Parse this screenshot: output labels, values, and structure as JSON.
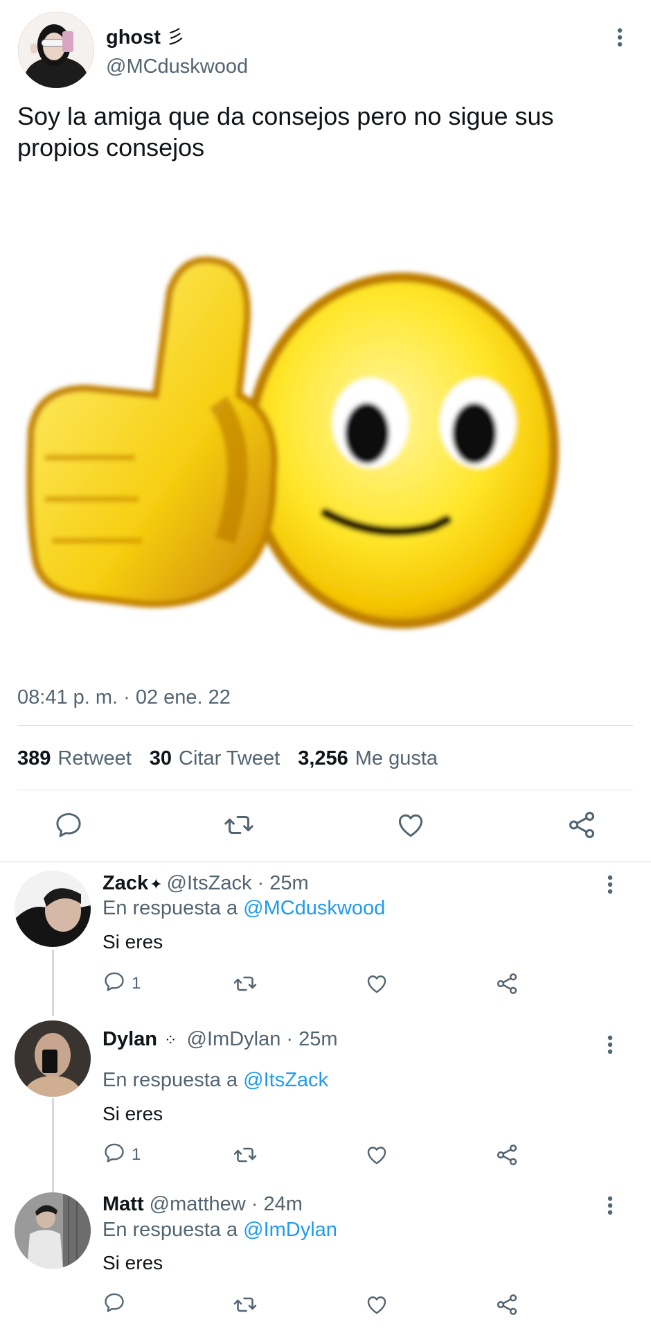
{
  "tweet": {
    "display_name": "ghost",
    "name_glyph": "彡",
    "handle": "@MCduskwood",
    "text": "Soy la amiga que da consejos pero no sigue sus propios consejos",
    "timestamp": "08:41 p. m. · 02 ene. 22",
    "stats": {
      "retweets": {
        "count": "389",
        "label": "Retweet"
      },
      "quotes": {
        "count": "30",
        "label": "Citar Tweet"
      },
      "likes": {
        "count": "3,256",
        "label": "Me gusta"
      }
    },
    "media_description": "thumbs-up-smiley-emoji"
  },
  "replies": [
    {
      "name": "Zack",
      "badge": "✦",
      "handle": "@ItsZack",
      "time": "· 25m",
      "reply_prefix": "En respuesta a",
      "reply_to": "@MCduskwood",
      "text": "Si eres",
      "reply_count": "1"
    },
    {
      "name": "Dylan",
      "badge": "⁘",
      "handle": "@ImDylan",
      "time": "· 25m",
      "reply_prefix": "En respuesta a",
      "reply_to": "@ItsZack",
      "text": "Si eres",
      "reply_count": "1"
    },
    {
      "name": "Matt",
      "badge": "",
      "handle": "@matthew",
      "time": "· 24m",
      "reply_prefix": "En respuesta a",
      "reply_to": "@ImDylan",
      "text": "Si eres",
      "reply_count": ""
    }
  ],
  "colors": {
    "accent": "#1d9bf0",
    "secondary_text": "#536471",
    "primary_text": "#0f1419",
    "divider": "#dfe3e6"
  },
  "icons": [
    "reply-icon",
    "retweet-icon",
    "like-icon",
    "share-icon",
    "more-options-icon"
  ]
}
